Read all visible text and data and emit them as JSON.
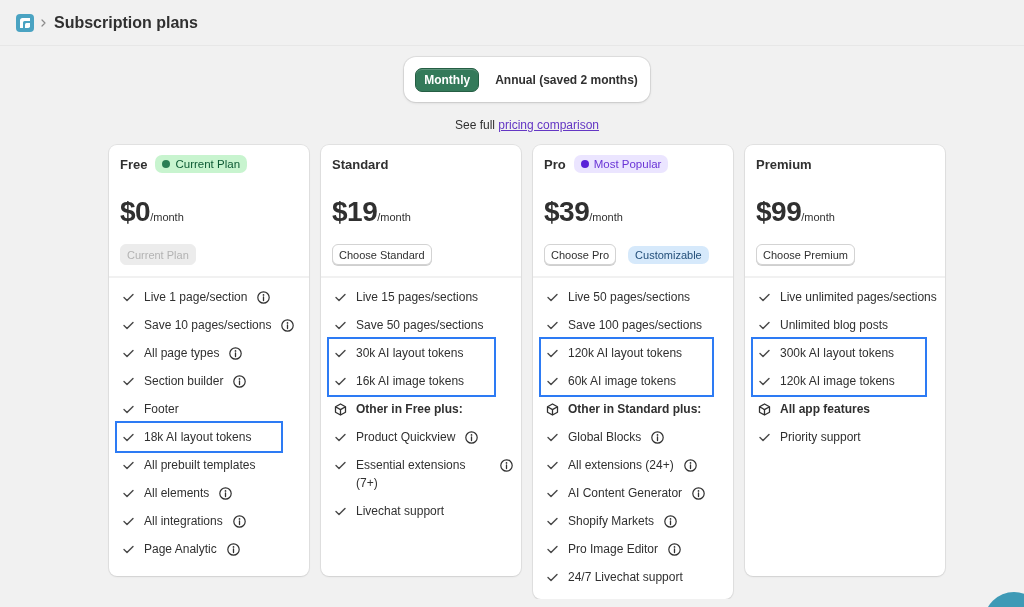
{
  "header": {
    "title": "Subscription plans"
  },
  "billing_toggle": {
    "options": [
      {
        "label": "Monthly",
        "selected": true
      },
      {
        "label": "Annual (saved 2 months)",
        "selected": false
      }
    ]
  },
  "comparison_note": {
    "text": "See full",
    "link": "pricing comparison"
  },
  "plans": [
    {
      "name": "Free",
      "badge": {
        "label": "Current Plan",
        "kind": "success"
      },
      "price": "$0",
      "period": "/month",
      "actions": [
        {
          "kind": "button",
          "label": "Current Plan",
          "disabled": true
        }
      ],
      "features": [
        {
          "kind": "check",
          "text": "Live 1 page/section",
          "info": true,
          "highlighted": false
        },
        {
          "kind": "check",
          "text": "Save 10 pages/sections",
          "info": true,
          "highlighted": false
        },
        {
          "kind": "check",
          "text": "All page types",
          "info": true,
          "highlighted": false
        },
        {
          "kind": "check",
          "text": "Section builder",
          "info": true,
          "highlighted": false
        },
        {
          "kind": "check",
          "text": "Footer",
          "info": false,
          "highlighted": false
        },
        {
          "kind": "check",
          "text": "18k AI layout tokens",
          "info": false,
          "highlighted": true
        },
        {
          "kind": "check",
          "text": "All prebuilt templates",
          "info": false,
          "highlighted": false
        },
        {
          "kind": "check",
          "text": "All elements",
          "info": true,
          "highlighted": false
        },
        {
          "kind": "check",
          "text": "All integrations",
          "info": true,
          "highlighted": false
        },
        {
          "kind": "check",
          "text": "Page Analytic",
          "info": true,
          "highlighted": false
        }
      ]
    },
    {
      "name": "Standard",
      "price": "$19",
      "period": "/month",
      "actions": [
        {
          "kind": "button",
          "label": "Choose Standard",
          "disabled": false
        }
      ],
      "features": [
        {
          "kind": "check",
          "text": "Live 15 pages/sections",
          "info": false,
          "highlighted": false
        },
        {
          "kind": "check",
          "text": "Save 50 pages/sections",
          "info": false,
          "highlighted": false
        },
        {
          "kind": "check",
          "text": "30k AI layout tokens",
          "info": false,
          "highlighted": true
        },
        {
          "kind": "check",
          "text": "16k AI image tokens",
          "info": false,
          "highlighted": true
        },
        {
          "kind": "group",
          "text": "Other in Free plus:",
          "info": false,
          "highlighted": false
        },
        {
          "kind": "check",
          "text": "Product Quickview",
          "info": true,
          "highlighted": false
        },
        {
          "kind": "check",
          "text": "Essential extensions (7+)",
          "info": true,
          "highlighted": false
        },
        {
          "kind": "check",
          "text": "Livechat support",
          "info": false,
          "highlighted": false
        }
      ]
    },
    {
      "name": "Pro",
      "badge": {
        "label": "Most Popular",
        "kind": "magic"
      },
      "price": "$39",
      "period": "/month",
      "actions": [
        {
          "kind": "button",
          "label": "Choose Pro",
          "disabled": false
        },
        {
          "kind": "tag",
          "label": "Customizable"
        }
      ],
      "features": [
        {
          "kind": "check",
          "text": "Live 50 pages/sections",
          "info": false,
          "highlighted": false
        },
        {
          "kind": "check",
          "text": "Save 100 pages/sections",
          "info": false,
          "highlighted": false
        },
        {
          "kind": "check",
          "text": "120k AI layout tokens",
          "info": false,
          "highlighted": true
        },
        {
          "kind": "check",
          "text": "60k AI image tokens",
          "info": false,
          "highlighted": true
        },
        {
          "kind": "group",
          "text": "Other in Standard plus:",
          "info": false,
          "highlighted": false
        },
        {
          "kind": "check",
          "text": "Global Blocks",
          "info": true,
          "highlighted": false
        },
        {
          "kind": "check",
          "text": "All extensions (24+)",
          "info": true,
          "highlighted": false
        },
        {
          "kind": "check",
          "text": "AI Content Generator",
          "info": true,
          "highlighted": false
        },
        {
          "kind": "check",
          "text": "Shopify Markets",
          "info": true,
          "highlighted": false
        },
        {
          "kind": "check",
          "text": "Pro Image Editor",
          "info": true,
          "highlighted": false
        },
        {
          "kind": "check",
          "text": "24/7 Livechat support",
          "info": false,
          "highlighted": false
        }
      ]
    },
    {
      "name": "Premium",
      "price": "$99",
      "period": "/month",
      "actions": [
        {
          "kind": "button",
          "label": "Choose Premium",
          "disabled": false
        }
      ],
      "features": [
        {
          "kind": "check",
          "text": "Live unlimited pages/sections",
          "info": false,
          "highlighted": false
        },
        {
          "kind": "check",
          "text": "Unlimited blog posts",
          "info": false,
          "highlighted": false
        },
        {
          "kind": "check",
          "text": "300k AI layout tokens",
          "info": false,
          "highlighted": true
        },
        {
          "kind": "check",
          "text": "120k AI image tokens",
          "info": false,
          "highlighted": true
        },
        {
          "kind": "group",
          "text": "All app features",
          "info": false,
          "highlighted": false
        },
        {
          "kind": "check",
          "text": "Priority support",
          "info": false,
          "highlighted": false
        }
      ]
    }
  ]
}
